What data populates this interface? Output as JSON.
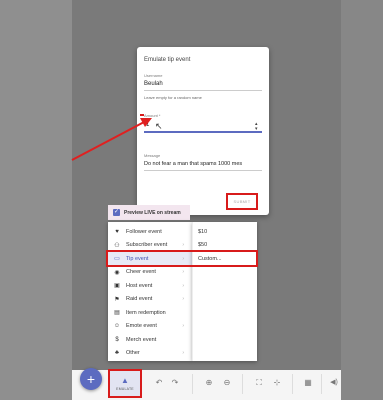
{
  "dialog": {
    "title": "Emulate tip event",
    "username_label": "Username",
    "username_value": "Beulah",
    "username_hint": "Leave empty for a random name",
    "amount_label": "Amount *",
    "amount_value": "-1",
    "message_label": "Message",
    "message_value": "Do not fear a man that spams 1000 mes",
    "submit_label": "SUBMIT"
  },
  "preview": {
    "label": "Preview LIVE on stream",
    "checked": true
  },
  "menu": {
    "items": [
      {
        "label": "Follower event",
        "icon": "heart-icon",
        "glyph": "♥",
        "has_sub": false
      },
      {
        "label": "Subscriber event",
        "icon": "person-add-icon",
        "glyph": "👤",
        "has_sub": true
      },
      {
        "label": "Tip event",
        "icon": "credit-card-icon",
        "glyph": "▭",
        "has_sub": true,
        "active": true
      },
      {
        "label": "Cheer event",
        "icon": "cheer-icon",
        "glyph": "◉",
        "has_sub": true
      },
      {
        "label": "Host event",
        "icon": "monitor-icon",
        "glyph": "▣",
        "has_sub": true
      },
      {
        "label": "Raid event",
        "icon": "raid-icon",
        "glyph": "⚑",
        "has_sub": true
      },
      {
        "label": "Item redemption",
        "icon": "gift-icon",
        "glyph": "▤",
        "has_sub": false
      },
      {
        "label": "Emote event",
        "icon": "emote-icon",
        "glyph": "☺",
        "has_sub": true
      },
      {
        "label": "Merch event",
        "icon": "dollar-icon",
        "glyph": "$",
        "has_sub": false
      },
      {
        "label": "Other",
        "icon": "other-icon",
        "glyph": "♣",
        "has_sub": true
      }
    ]
  },
  "submenu": {
    "items": [
      "$10",
      "$50",
      "Custom..."
    ]
  },
  "toolbar": {
    "add_glyph": "+",
    "emulate_label": "EMULATE",
    "emulate_glyph": "▲",
    "undo_glyph": "↶",
    "redo_glyph": "↷",
    "zoom_in_glyph": "⊕",
    "zoom_out_glyph": "⊖",
    "fit_glyph": "⛶",
    "center_glyph": "⊹",
    "grid_glyph": "▦",
    "volume_glyph": "🔊"
  },
  "colors": {
    "accent": "#5c6bc0",
    "highlight": "#d81b1b"
  }
}
